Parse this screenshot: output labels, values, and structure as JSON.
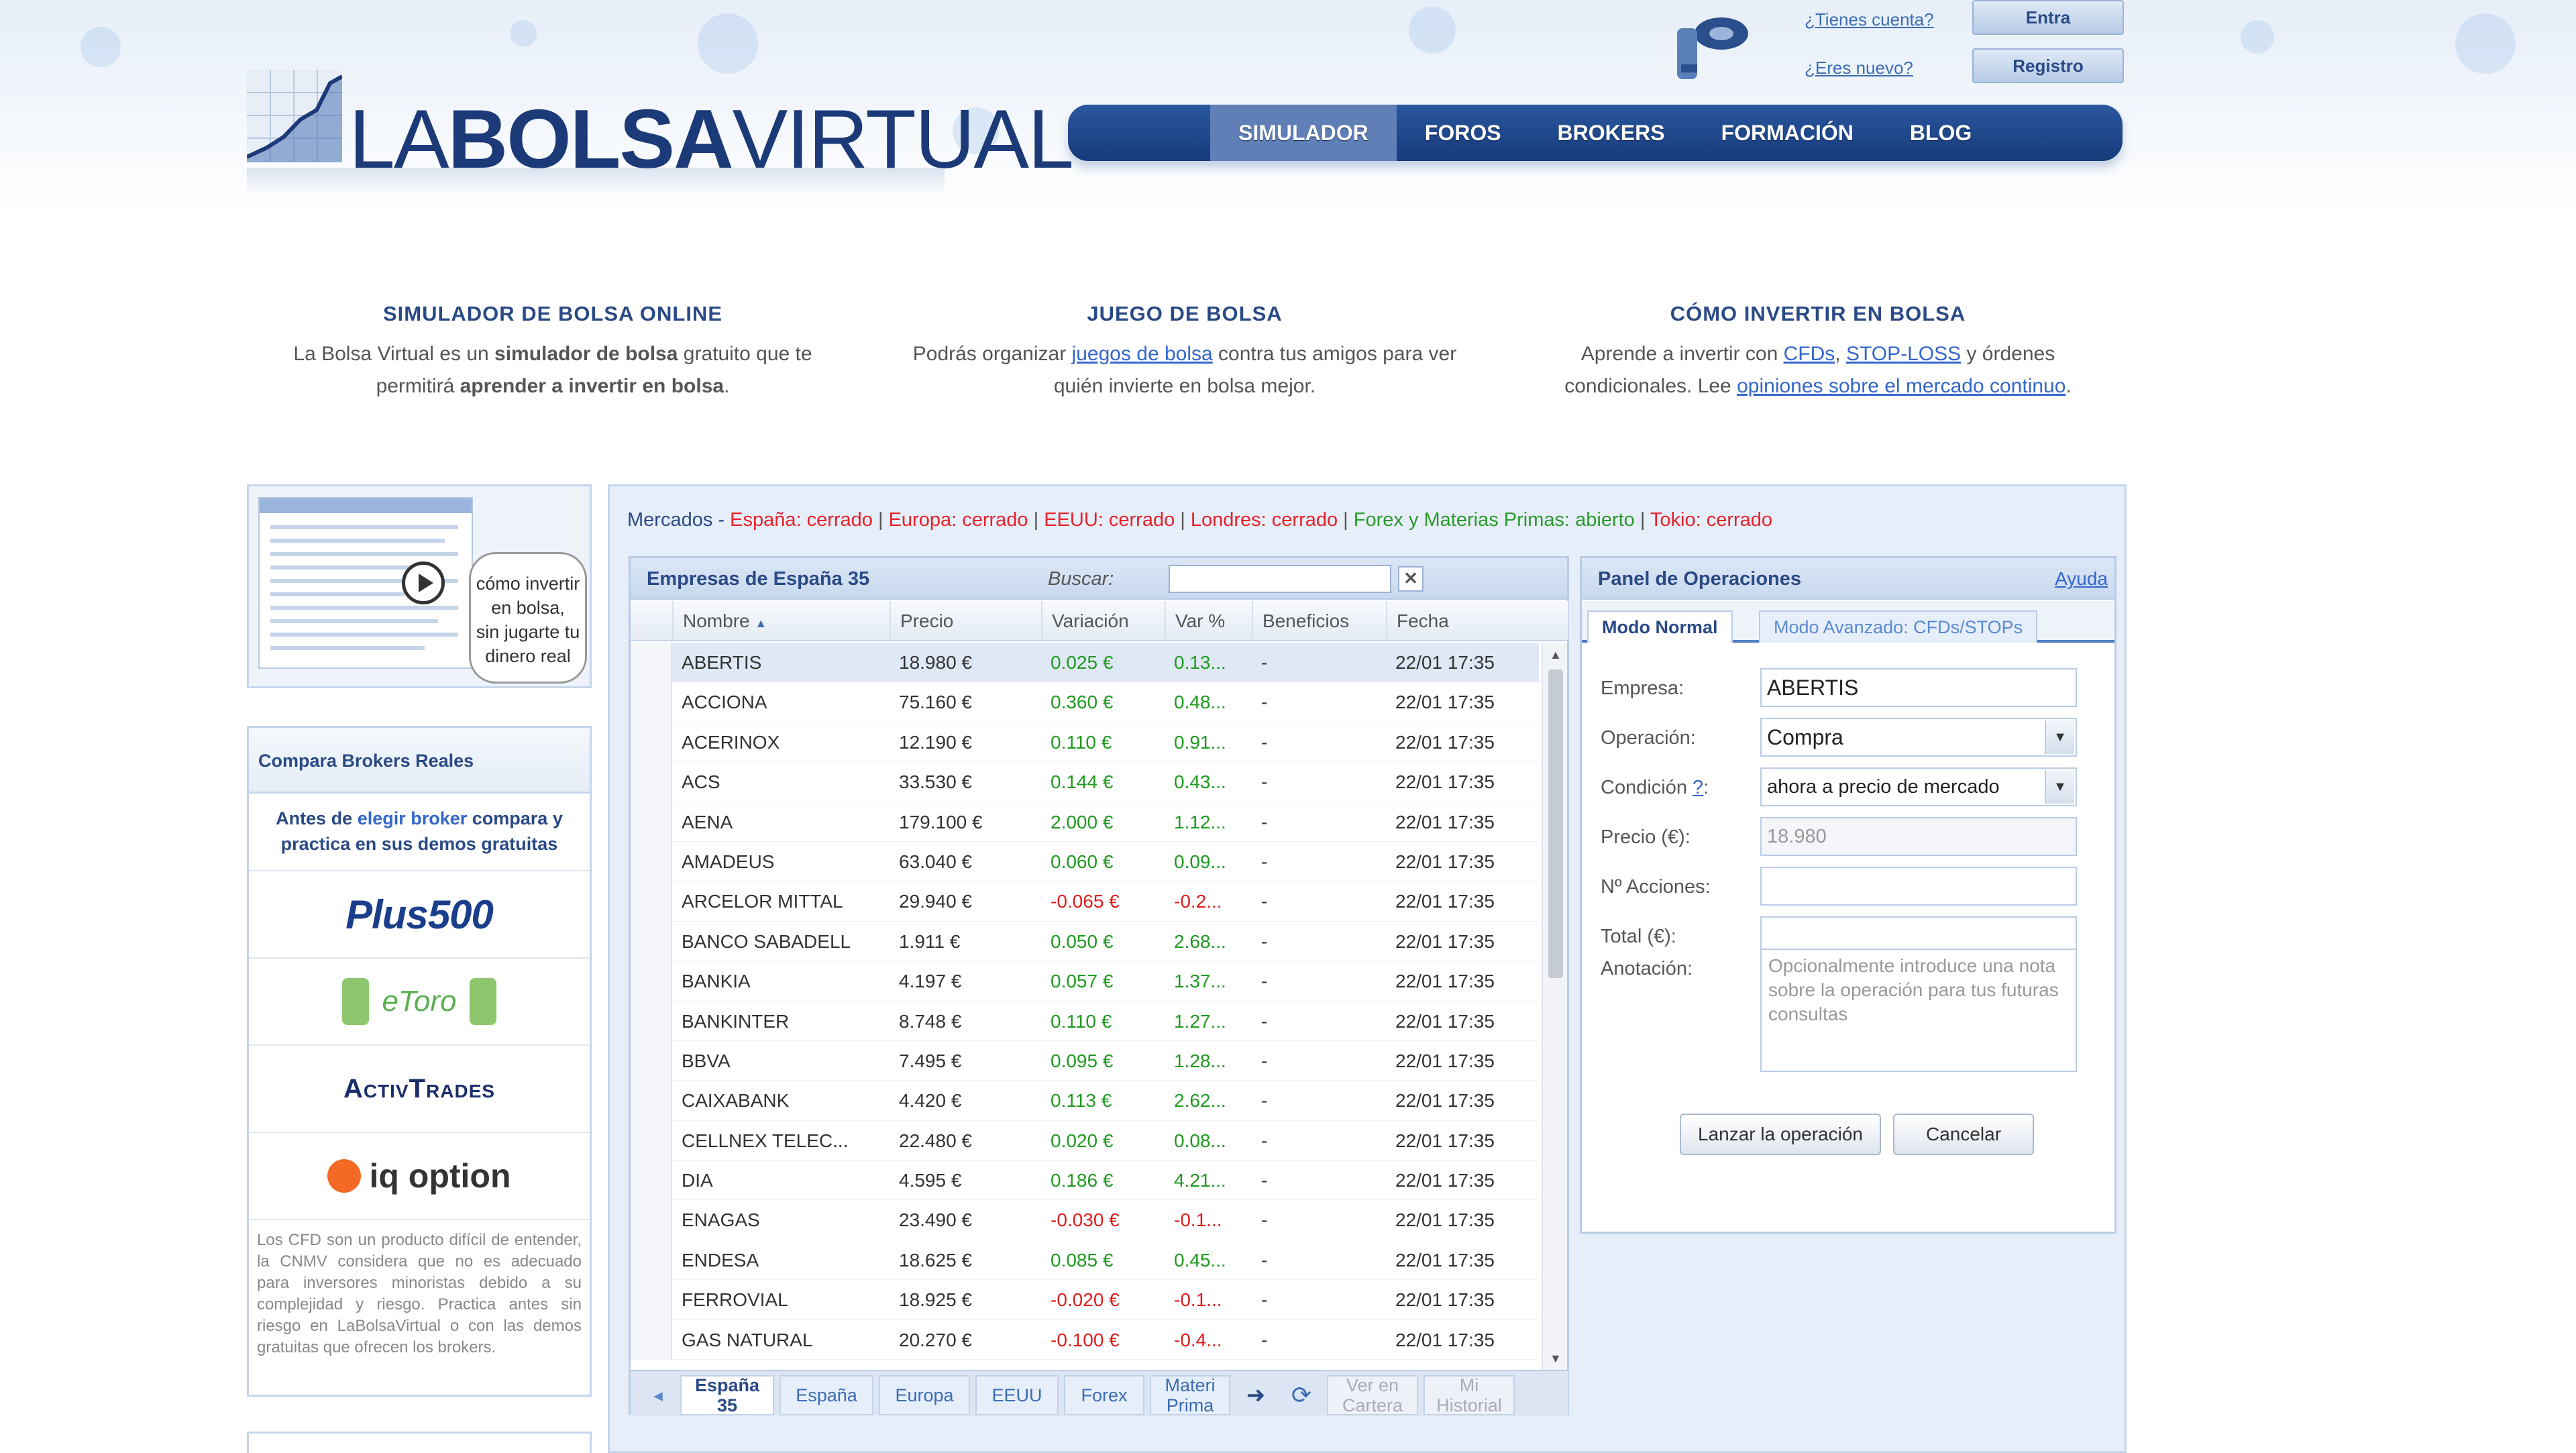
{
  "header": {
    "logo_bold": "BOLSA",
    "logo_pre": "LA",
    "logo_post": "VIRTUAL",
    "account_q1": "¿Tienes cuenta?",
    "account_q2": "¿Eres nuevo?",
    "login_label": "Entra",
    "register_label": "Registro"
  },
  "nav": [
    "SIMULADOR",
    "FOROS",
    "BROKERS",
    "FORMACIÓN",
    "BLOG"
  ],
  "intro": [
    {
      "title": "SIMULADOR DE BOLSA ONLINE",
      "p1": "La Bolsa Virtual es un ",
      "b1": "simulador de bolsa",
      "p2": " gratuito que te permitirá ",
      "b2": "aprender a invertir en bolsa",
      "p3": "."
    },
    {
      "title": "JUEGO DE BOLSA",
      "p1": "Podrás organizar ",
      "link1": "juegos de bolsa",
      "p2": " contra tus amigos para ver quién invierte en bolsa mejor."
    },
    {
      "title": "CÓMO INVERTIR EN BOLSA",
      "p1": "Aprende a invertir con ",
      "link1": "CFDs",
      "sep": ", ",
      "link2": "STOP-LOSS",
      "p2": " y órdenes condicionales. Lee ",
      "link3": "opiniones sobre el mercado continuo",
      "p3": "."
    }
  ],
  "video": {
    "caption_lines": [
      "cómo invertir",
      "en bolsa,",
      "sin jugarte tu",
      "dinero real"
    ]
  },
  "brokers": {
    "title": "Compara Brokers Reales",
    "intro_pre": "Antes de ",
    "intro_link": "elegir broker",
    "intro_post": " compara y practica en sus demos gratuitas",
    "logos": [
      "Plus500",
      "eToro",
      "ActivTrades",
      "iq option"
    ],
    "disclaimer": "Los CFD son un producto difícil de entender, la CNMV considera que no es adecuado para inversores minoristas debido a su complejidad y riesgo. Practica antes sin riesgo en LaBolsaVirtual o con las demos gratuitas que ofrecen los brokers."
  },
  "markets": {
    "label": "Mercados - ",
    "items": [
      {
        "text": "España: cerrado",
        "state": "closed"
      },
      {
        "text": "Europa: cerrado",
        "state": "closed"
      },
      {
        "text": "EEUU: cerrado",
        "state": "closed"
      },
      {
        "text": "Londres: cerrado",
        "state": "closed"
      },
      {
        "text": "Forex y Materias Primas: abierto",
        "state": "open"
      },
      {
        "text": "Tokio: cerrado",
        "state": "closed"
      }
    ]
  },
  "grid": {
    "title": "Empresas de España 35",
    "search_label": "Buscar:",
    "search_value": "",
    "columns": [
      "Nombre",
      "Precio",
      "Variación",
      "Var %",
      "Beneficios",
      "Fecha"
    ],
    "sort_indicator": "▲",
    "rows": [
      [
        "ABERTIS",
        "18.980 €",
        "0.025 €",
        "0.13...",
        "-",
        "22/01 17:35",
        "up"
      ],
      [
        "ACCIONA",
        "75.160 €",
        "0.360 €",
        "0.48...",
        "-",
        "22/01 17:35",
        "up"
      ],
      [
        "ACERINOX",
        "12.190 €",
        "0.110 €",
        "0.91...",
        "-",
        "22/01 17:35",
        "up"
      ],
      [
        "ACS",
        "33.530 €",
        "0.144 €",
        "0.43...",
        "-",
        "22/01 17:35",
        "up"
      ],
      [
        "AENA",
        "179.100 €",
        "2.000 €",
        "1.12...",
        "-",
        "22/01 17:35",
        "up"
      ],
      [
        "AMADEUS",
        "63.040 €",
        "0.060 €",
        "0.09...",
        "-",
        "22/01 17:35",
        "up"
      ],
      [
        "ARCELOR MITTAL",
        "29.940 €",
        "-0.065 €",
        "-0.2...",
        "-",
        "22/01 17:35",
        "down"
      ],
      [
        "BANCO SABADELL",
        "1.911 €",
        "0.050 €",
        "2.68...",
        "-",
        "22/01 17:35",
        "up"
      ],
      [
        "BANKIA",
        "4.197 €",
        "0.057 €",
        "1.37...",
        "-",
        "22/01 17:35",
        "up"
      ],
      [
        "BANKINTER",
        "8.748 €",
        "0.110 €",
        "1.27...",
        "-",
        "22/01 17:35",
        "up"
      ],
      [
        "BBVA",
        "7.495 €",
        "0.095 €",
        "1.28...",
        "-",
        "22/01 17:35",
        "up"
      ],
      [
        "CAIXABANK",
        "4.420 €",
        "0.113 €",
        "2.62...",
        "-",
        "22/01 17:35",
        "up"
      ],
      [
        "CELLNEX TELEC...",
        "22.480 €",
        "0.020 €",
        "0.08...",
        "-",
        "22/01 17:35",
        "up"
      ],
      [
        "DIA",
        "4.595 €",
        "0.186 €",
        "4.21...",
        "-",
        "22/01 17:35",
        "up"
      ],
      [
        "ENAGAS",
        "23.490 €",
        "-0.030 €",
        "-0.1...",
        "-",
        "22/01 17:35",
        "down"
      ],
      [
        "ENDESA",
        "18.625 €",
        "0.085 €",
        "0.45...",
        "-",
        "22/01 17:35",
        "up"
      ],
      [
        "FERROVIAL",
        "18.925 €",
        "-0.020 €",
        "-0.1...",
        "-",
        "22/01 17:35",
        "down"
      ],
      [
        "GAS NATURAL",
        "20.270 €",
        "-0.100 €",
        "-0.4...",
        "-",
        "22/01 17:35",
        "down"
      ]
    ],
    "tabs": [
      {
        "label": "España 35",
        "state": "active"
      },
      {
        "label": "España",
        "state": "normal"
      },
      {
        "label": "Europa",
        "state": "normal"
      },
      {
        "label": "EEUU",
        "state": "normal"
      },
      {
        "label": "Forex",
        "state": "normal"
      },
      {
        "label": "Materi Prima",
        "state": "normal"
      },
      {
        "label": "Ver en Cartera",
        "state": "dim"
      },
      {
        "label": "Mi Historial",
        "state": "dim"
      }
    ]
  },
  "ops": {
    "title": "Panel de Operaciones",
    "help": "Ayuda",
    "tab_normal": "Modo Normal",
    "tab_advanced": "Modo Avanzado: CFDs/STOPs",
    "empresa_label": "Empresa:",
    "empresa_value": "ABERTIS",
    "operacion_label": "Operación:",
    "operacion_value": "Compra",
    "condicion_label": "Condición ",
    "condicion_help": "?",
    "condicion_suffix": ":",
    "condicion_value": "ahora a precio de mercado",
    "precio_label": "Precio (€):",
    "precio_value": "18.980",
    "acciones_label": "Nº Acciones:",
    "acciones_value": "",
    "total_label": "Total (€):",
    "total_value": "",
    "anotacion_label": "Anotación:",
    "anotacion_placeholder": "Opcionalmente introduce una nota sobre la operación para tus futuras consultas",
    "submit": "Lanzar la operación",
    "cancel": "Cancelar"
  }
}
